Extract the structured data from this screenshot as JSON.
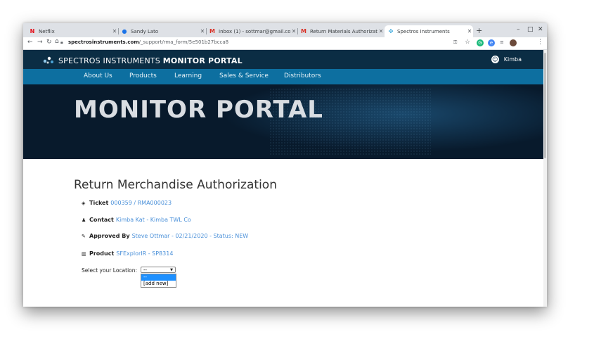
{
  "browser": {
    "tabs": [
      {
        "title": "Netflix",
        "icon": "netflix-icon"
      },
      {
        "title": "Sandy Lato",
        "icon": "circle-app-icon"
      },
      {
        "title": "Inbox (1) - sottmar@gmail.co",
        "icon": "gmail-icon"
      },
      {
        "title": "Return Materials Authorizatio",
        "icon": "gmail-icon"
      },
      {
        "title": "Spectros Instruments",
        "icon": "spectros-icon"
      }
    ],
    "url_host": "spectrosinstruments.com",
    "url_path": "/_support/rma_form/5e501b27bcca8"
  },
  "site": {
    "brand_light": "SPECTROS INSTRUMENTS",
    "brand_bold": "MONITOR PORTAL",
    "user": "Kimba",
    "nav": [
      "About Us",
      "Products",
      "Learning",
      "Sales & Service",
      "Distributors"
    ],
    "hero_title": "MONITOR PORTAL"
  },
  "rma": {
    "heading": "Return Merchandise Authorization",
    "ticket_label": "Ticket",
    "ticket_value": "000359 / RMA000023",
    "contact_label": "Contact",
    "contact_value": "Kimba Kat - Kimba TWL Co",
    "approved_label": "Approved By",
    "approved_value": "Steve Ottmar - 02/21/2020 - Status: NEW",
    "product_label": "Product",
    "product_value": "SFExplorIR - SP8314",
    "location_label": "Select your Location:",
    "location_selected": "--",
    "location_options": [
      "--",
      "[add new]"
    ]
  }
}
